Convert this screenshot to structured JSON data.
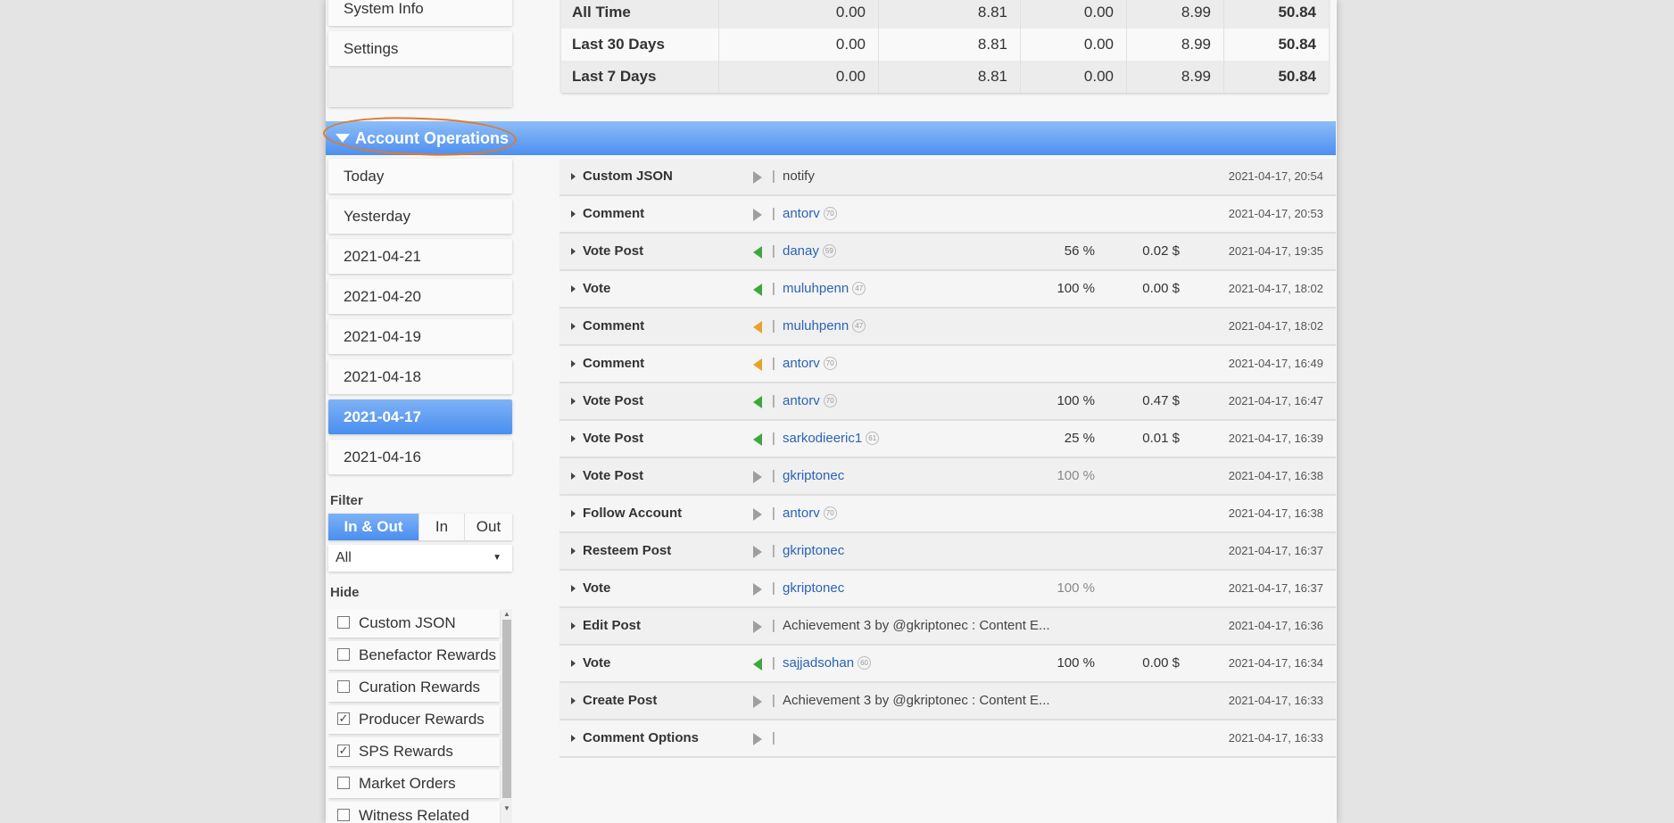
{
  "sidebar_top": {
    "items": [
      {
        "label": "System Info"
      },
      {
        "label": "Settings"
      }
    ]
  },
  "stats": {
    "rows": [
      {
        "label": "All Time",
        "v1": "0.00",
        "v2": "8.81",
        "v3": "0.00",
        "v4": "8.99",
        "total": "50.84"
      },
      {
        "label": "Last 30 Days",
        "v1": "0.00",
        "v2": "8.81",
        "v3": "0.00",
        "v4": "8.99",
        "total": "50.84"
      },
      {
        "label": "Last 7 Days",
        "v1": "0.00",
        "v2": "8.81",
        "v3": "0.00",
        "v4": "8.99",
        "total": "50.84"
      }
    ]
  },
  "section": {
    "title": "Account Operations",
    "annotation_color": "#e07a2a"
  },
  "dates": {
    "items": [
      {
        "label": "Today"
      },
      {
        "label": "Yesterday"
      },
      {
        "label": "2021-04-21"
      },
      {
        "label": "2021-04-20"
      },
      {
        "label": "2021-04-19"
      },
      {
        "label": "2021-04-18"
      },
      {
        "label": "2021-04-17"
      },
      {
        "label": "2021-04-16"
      }
    ],
    "selected": "2021-04-17"
  },
  "filter": {
    "label": "Filter",
    "options": [
      {
        "label": "In & Out"
      },
      {
        "label": "In"
      },
      {
        "label": "Out"
      }
    ],
    "selected": "In & Out",
    "select_value": "All"
  },
  "hide": {
    "label": "Hide",
    "items": [
      {
        "label": "Custom JSON",
        "checked": false,
        "mark": ""
      },
      {
        "label": "Benefactor Rewards",
        "checked": false,
        "mark": ""
      },
      {
        "label": "Curation Rewards",
        "checked": false,
        "mark": ""
      },
      {
        "label": "Producer Rewards",
        "checked": true,
        "mark": "✓"
      },
      {
        "label": "SPS Rewards",
        "checked": true,
        "mark": "✓"
      },
      {
        "label": "Market Orders",
        "checked": false,
        "mark": ""
      },
      {
        "label": "Witness Related",
        "checked": false,
        "mark": ""
      }
    ]
  },
  "operations": [
    {
      "type": "Custom JSON",
      "dir": "neutral",
      "subject": "notify",
      "subject_link": false,
      "rep": "",
      "pct": "",
      "value": "",
      "time": "2021-04-17, 20:54"
    },
    {
      "type": "Comment",
      "dir": "neutral",
      "subject": "antorv",
      "subject_link": true,
      "rep": "70",
      "pct": "",
      "value": "",
      "time": "2021-04-17, 20:53"
    },
    {
      "type": "Vote Post",
      "dir": "in",
      "subject": "danay",
      "subject_link": true,
      "rep": "59",
      "pct": "56 %",
      "value": "0.02 $",
      "time": "2021-04-17, 19:35"
    },
    {
      "type": "Vote",
      "dir": "in",
      "subject": "muluhpenn",
      "subject_link": true,
      "rep": "47",
      "pct": "100 %",
      "value": "0.00 $",
      "time": "2021-04-17, 18:02"
    },
    {
      "type": "Comment",
      "dir": "out",
      "subject": "muluhpenn",
      "subject_link": true,
      "rep": "47",
      "pct": "",
      "value": "",
      "time": "2021-04-17, 18:02"
    },
    {
      "type": "Comment",
      "dir": "out",
      "subject": "antorv",
      "subject_link": true,
      "rep": "70",
      "pct": "",
      "value": "",
      "time": "2021-04-17, 16:49"
    },
    {
      "type": "Vote Post",
      "dir": "in",
      "subject": "antorv",
      "subject_link": true,
      "rep": "70",
      "pct": "100 %",
      "value": "0.47 $",
      "time": "2021-04-17, 16:47"
    },
    {
      "type": "Vote Post",
      "dir": "in",
      "subject": "sarkodieeric1",
      "subject_link": true,
      "rep": "61",
      "pct": "25 %",
      "value": "0.01 $",
      "time": "2021-04-17, 16:39"
    },
    {
      "type": "Vote Post",
      "dir": "neutral",
      "subject": "gkriptonec",
      "subject_link": true,
      "rep": "",
      "pct": "100 %",
      "value": "",
      "time": "2021-04-17, 16:38"
    },
    {
      "type": "Follow Account",
      "dir": "neutral",
      "subject": "antorv",
      "subject_link": true,
      "rep": "70",
      "pct": "",
      "value": "",
      "time": "2021-04-17, 16:38"
    },
    {
      "type": "Resteem Post",
      "dir": "neutral",
      "subject": "gkriptonec",
      "subject_link": true,
      "rep": "",
      "pct": "",
      "value": "",
      "time": "2021-04-17, 16:37"
    },
    {
      "type": "Vote",
      "dir": "neutral",
      "subject": "gkriptonec",
      "subject_link": true,
      "rep": "",
      "pct": "100 %",
      "value": "",
      "time": "2021-04-17, 16:37"
    },
    {
      "type": "Edit Post",
      "dir": "neutral",
      "subject": "Achievement 3 by @gkriptonec : Content E...",
      "subject_link": false,
      "rep": "",
      "pct": "",
      "value": "",
      "time": "2021-04-17, 16:36"
    },
    {
      "type": "Vote",
      "dir": "in",
      "subject": "sajjadsohan",
      "subject_link": true,
      "rep": "60",
      "pct": "100 %",
      "value": "0.00 $",
      "time": "2021-04-17, 16:34"
    },
    {
      "type": "Create Post",
      "dir": "neutral",
      "subject": "Achievement 3 by @gkriptonec : Content E...",
      "subject_link": false,
      "rep": "",
      "pct": "",
      "value": "",
      "time": "2021-04-17, 16:33"
    },
    {
      "type": "Comment Options",
      "dir": "neutral",
      "subject": "",
      "subject_link": false,
      "rep": "",
      "pct": "",
      "value": "",
      "time": "2021-04-17, 16:33"
    }
  ]
}
